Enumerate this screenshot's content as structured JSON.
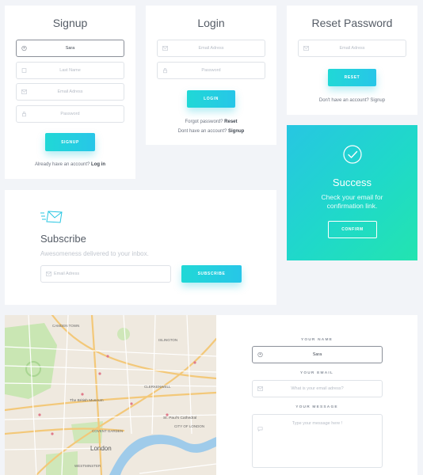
{
  "signup": {
    "title": "Signup",
    "first_name_value": "Sara",
    "last_name_placeholder": "Last Name",
    "email_placeholder": "Email Adress",
    "password_placeholder": "Password",
    "button_label": "SIGNUP",
    "footer_prefix": "Already have an account?",
    "footer_link": "Log in"
  },
  "login": {
    "title": "Login",
    "email_placeholder": "Email Adress",
    "password_placeholder": "Password",
    "button_label": "LOGIN",
    "forgot_prefix": "Forgot password?",
    "forgot_link": "Reset",
    "no_account_prefix": "Dont have an account?",
    "no_account_link": "Signup"
  },
  "reset": {
    "title": "Reset Password",
    "email_placeholder": "Email Adress",
    "button_label": "RESET",
    "footer_prefix": "Don't have an account?",
    "footer_link": "Signup"
  },
  "success": {
    "title": "Success",
    "message_line1": "Check your email for",
    "message_line2": "confirmation link.",
    "button_label": "CONFIRM"
  },
  "subscribe": {
    "title": "Subscribe",
    "subtitle": "Awesomeness delivered to your inbox.",
    "email_placeholder": "Email Adress",
    "button_label": "SUBSCRIBE"
  },
  "map": {
    "labels": [
      "CAMDEN TOWN",
      "ISLINGTON",
      "CLERKENWELL",
      "The British Museum",
      "St. Paul's Cathedral",
      "CITY OF LONDON",
      "COVENT GARDEN",
      "London",
      "WESTMINSTER"
    ]
  },
  "contact": {
    "name_label": "YOUR NAME",
    "name_value": "Sara",
    "email_label": "YOUR EMAIL",
    "email_placeholder": "What is your email adress?",
    "message_label": "YOUR MESSAGE",
    "message_placeholder": "Type your message here !"
  },
  "colors": {
    "accent_start": "#20d8d6",
    "accent_end": "#27c6e8",
    "background": "#f2f4f8"
  }
}
